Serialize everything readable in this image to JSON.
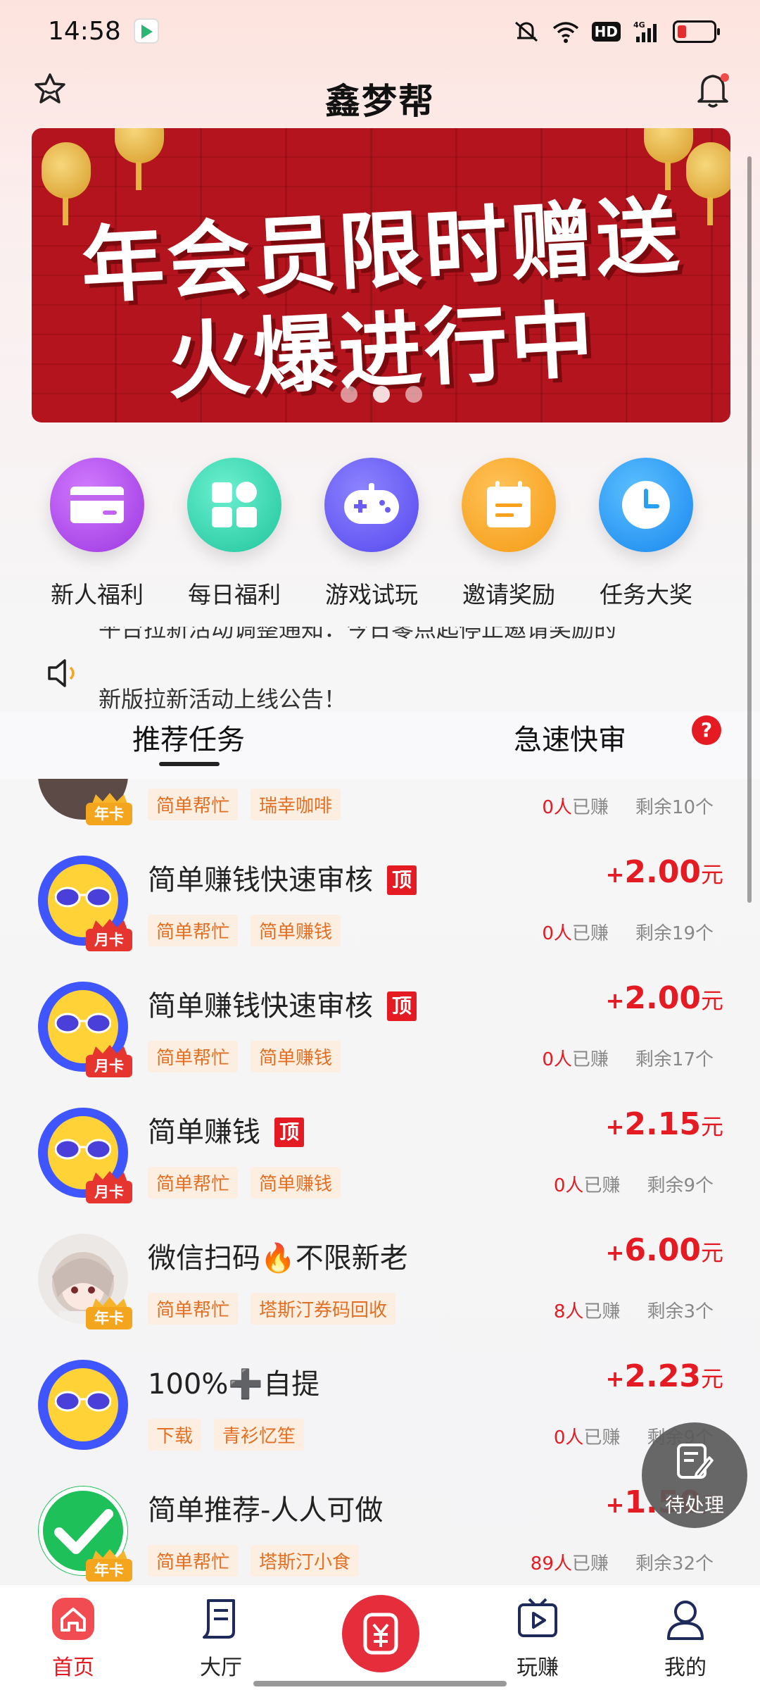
{
  "status_bar": {
    "time": "14:58",
    "hd": "HD",
    "network": "4G"
  },
  "header": {
    "title": "鑫梦帮"
  },
  "banner": {
    "line1": "年会员限时赠送",
    "line2": "火爆进行中",
    "active_dot": 1
  },
  "quick_actions": [
    {
      "label": "新人福利",
      "icon": "card-icon",
      "color": "#b34de8"
    },
    {
      "label": "每日福利",
      "icon": "grid-icon",
      "color": "#2ed6b0"
    },
    {
      "label": "游戏试玩",
      "icon": "gamepad-icon",
      "color": "#6a5cf5"
    },
    {
      "label": "邀请奖励",
      "icon": "calendar-icon",
      "color": "#f8a620"
    },
    {
      "label": "任务大奖",
      "icon": "clock-icon",
      "color": "#2a9ff2"
    }
  ],
  "notice": {
    "previous": "平台拉新活动调整通知：今日零点起停止邀请奖励的",
    "current": "新版拉新活动上线公告！"
  },
  "tabs": {
    "recommended": "推荐任务",
    "fast_review": "急速快审",
    "help": "?"
  },
  "tasks": [
    {
      "title": "",
      "badge": "年卡",
      "top": false,
      "tags": [
        "简单帮忙",
        "瑞幸咖啡"
      ],
      "reward": "",
      "earned": "0人",
      "earned_suffix": "已赚",
      "remaining": "剩余10个"
    },
    {
      "title": "简单赚钱快速审核",
      "badge": "月卡",
      "top": true,
      "tags": [
        "简单帮忙",
        "简单赚钱"
      ],
      "plus": "+",
      "reward": "2.00",
      "unit": "元",
      "earned": "0人",
      "earned_suffix": "已赚",
      "remaining": "剩余19个"
    },
    {
      "title": "简单赚钱快速审核",
      "badge": "月卡",
      "top": true,
      "tags": [
        "简单帮忙",
        "简单赚钱"
      ],
      "plus": "+",
      "reward": "2.00",
      "unit": "元",
      "earned": "0人",
      "earned_suffix": "已赚",
      "remaining": "剩余17个"
    },
    {
      "title": "简单赚钱",
      "badge": "月卡",
      "top": true,
      "tags": [
        "简单帮忙",
        "简单赚钱"
      ],
      "plus": "+",
      "reward": "2.15",
      "unit": "元",
      "earned": "0人",
      "earned_suffix": "已赚",
      "remaining": "剩余9个"
    },
    {
      "title": "微信扫码🔥不限新老",
      "badge": "年卡",
      "top": false,
      "tags": [
        "简单帮忙",
        "塔斯汀券码回收"
      ],
      "plus": "+",
      "reward": "6.00",
      "unit": "元",
      "earned": "8人",
      "earned_suffix": "已赚",
      "remaining": "剩余3个"
    },
    {
      "title": "100%➕自提",
      "badge": "",
      "top": false,
      "tags": [
        "下载",
        "青衫忆笙"
      ],
      "plus": "+",
      "reward": "2.23",
      "unit": "元",
      "earned": "0人",
      "earned_suffix": "已赚",
      "remaining": "剩余9个"
    },
    {
      "title": "简单推荐-人人可做",
      "badge": "年卡",
      "top": false,
      "tags": [
        "简单帮忙",
        "塔斯汀小食"
      ],
      "plus": "+",
      "reward": "1.50",
      "unit": "元",
      "earned": "89人",
      "earned_suffix": "已赚",
      "remaining": "剩余32个"
    }
  ],
  "ding_label": "顶",
  "fab": {
    "label": "待处理"
  },
  "bottom_nav": {
    "home": "首页",
    "hall": "大厅",
    "play": "玩赚",
    "mine": "我的"
  }
}
